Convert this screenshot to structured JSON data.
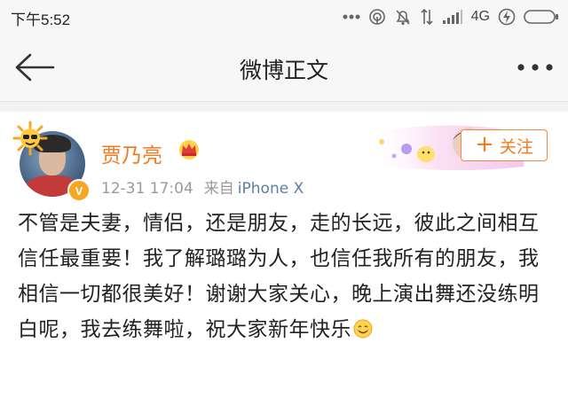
{
  "status_bar": {
    "time": "下午5:52",
    "network": "4G",
    "icons": [
      "more-dots-icon",
      "hotspot-icon",
      "mute-bell-icon",
      "data-transfer-icon",
      "signal-icon",
      "charging-icon",
      "battery-icon"
    ]
  },
  "nav": {
    "title": "微博正文",
    "back_icon": "back-arrow-icon",
    "more_icon": "more-icon"
  },
  "post": {
    "author": "贾乃亮",
    "date": "12-31 17:04",
    "source_label": "来自",
    "device": "iPhone X",
    "follow_label": "关注",
    "text": "不管是夫妻，情侣，还是朋友，走的长远，彼此之间相互信任最重要！我了解璐璐为人，也信任我所有的朋友，我相信一切都很美好！谢谢大家关心，晚上演出舞还没练明白呢，我去练舞啦，祝大家新年快乐",
    "emoji": "smile-emoji-icon",
    "verified_mark": "V",
    "accent_color": "#f37a1f",
    "link_color": "#5b7ea6"
  }
}
